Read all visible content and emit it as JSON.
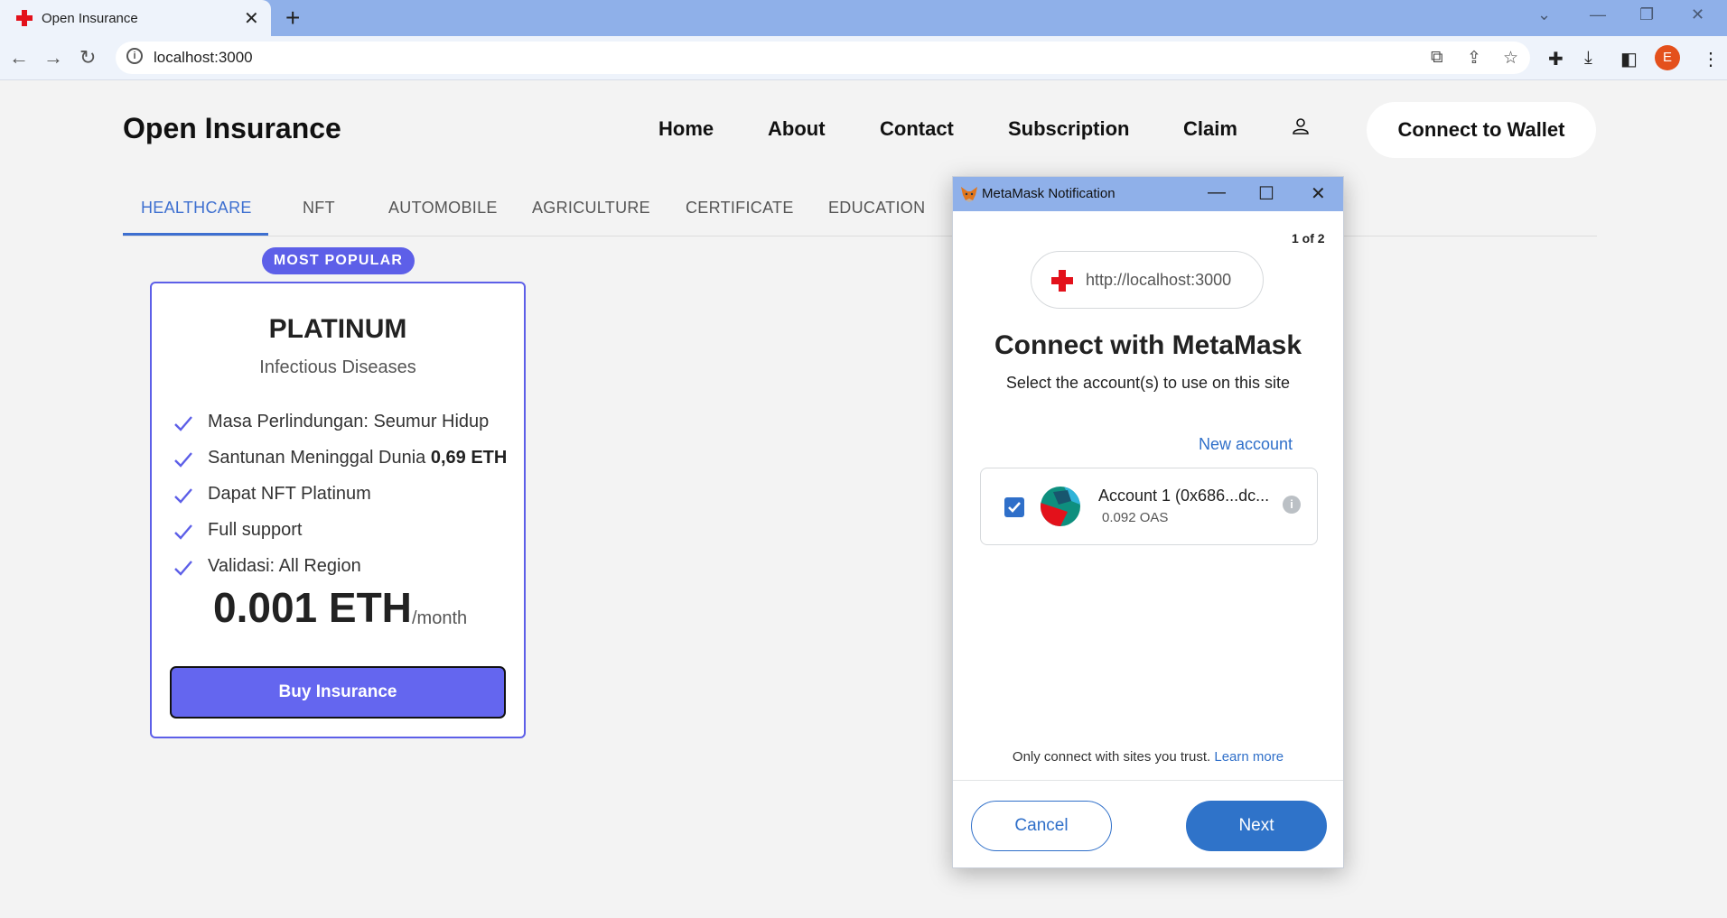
{
  "browser": {
    "tab_title": "Open Insurance",
    "url": "localhost:3000",
    "profile_initial": "E"
  },
  "site": {
    "brand": "Open Insurance",
    "nav": [
      "Home",
      "About",
      "Contact",
      "Subscription",
      "Claim"
    ],
    "wallet_button": "Connect to Wallet",
    "categories": [
      "HEALTHCARE",
      "NFT",
      "AUTOMOBILE",
      "AGRICULTURE",
      "CERTIFICATE",
      "EDUCATION"
    ],
    "active_category": "HEALTHCARE"
  },
  "plan": {
    "badge": "MOST POPULAR",
    "name": "PLATINUM",
    "subtitle": "Infectious Diseases",
    "features": [
      {
        "text": "Masa Perlindungan: Seumur Hidup",
        "bold": ""
      },
      {
        "text": "Santunan Meninggal Dunia ",
        "bold": "0,69 ETH"
      },
      {
        "text": "Dapat NFT Platinum",
        "bold": ""
      },
      {
        "text": "Full support",
        "bold": ""
      },
      {
        "text": "Validasi: All Region",
        "bold": ""
      }
    ],
    "price": "0.001 ETH",
    "period": "/month",
    "buy_button": "Buy Insurance"
  },
  "metamask": {
    "window_title": "MetaMask Notification",
    "page_count": "1 of 2",
    "site_url": "http://localhost:3000",
    "heading": "Connect with MetaMask",
    "subheading": "Select the account(s) to use on this site",
    "new_account": "New account",
    "account_name": "Account 1 (0x686...dc...",
    "account_balance": "0.092 OAS",
    "account_checked": true,
    "trust_text": "Only connect with sites you trust.",
    "learn_more": "Learn more",
    "cancel": "Cancel",
    "next": "Next"
  },
  "colors": {
    "accent": "#5d5fe8",
    "active_tab": "#3d6fd0",
    "metamask_blue": "#2f73c9",
    "chrome_frame": "#8fb0e9"
  }
}
